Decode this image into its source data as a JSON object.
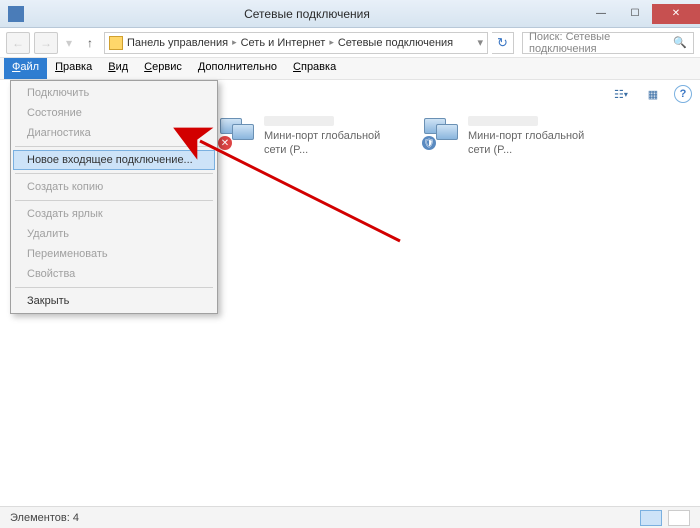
{
  "titlebar": {
    "title": "Сетевые подключения"
  },
  "nav": {
    "back_icon": "←",
    "fwd_icon": "→",
    "up_icon": "↑",
    "refresh_icon": "↻",
    "dropdown_icon": "▾"
  },
  "address": {
    "parts": [
      "Панель управления",
      "Сеть и Интернет",
      "Сетевые подключения"
    ],
    "sep": "▸"
  },
  "search": {
    "placeholder": "Поиск: Сетевые подключения",
    "icon": "🔍"
  },
  "menubar": {
    "items": [
      "Файл",
      "Правка",
      "Вид",
      "Сервис",
      "Дополнительно",
      "Справка"
    ],
    "activeIndex": 0
  },
  "toolbar": {
    "view_icon": "☷",
    "layout_icon": "▦",
    "help_icon": "?"
  },
  "dropdown": {
    "items": [
      {
        "label": "Подключить",
        "disabled": true
      },
      {
        "label": "Состояние",
        "disabled": true
      },
      {
        "label": "Диагностика",
        "disabled": true
      },
      {
        "divider": true
      },
      {
        "label": "Новое входящее подключение...",
        "highlight": true
      },
      {
        "divider": true
      },
      {
        "label": "Создать копию",
        "disabled": true
      },
      {
        "divider": true
      },
      {
        "label": "Создать ярлык",
        "disabled": true
      },
      {
        "label": "Удалить",
        "disabled": true
      },
      {
        "label": "Переименовать",
        "disabled": true
      },
      {
        "label": "Свойства",
        "disabled": true
      },
      {
        "divider": true
      },
      {
        "label": "Закрыть",
        "disabled": false
      }
    ]
  },
  "connections": [
    {
      "desc": "Мини-порт глобальной сети (P...",
      "mark": "x"
    },
    {
      "desc": "Мини-порт глобальной сети (P...",
      "mark": "e"
    }
  ],
  "statusbar": {
    "text": "Элементов: 4"
  }
}
